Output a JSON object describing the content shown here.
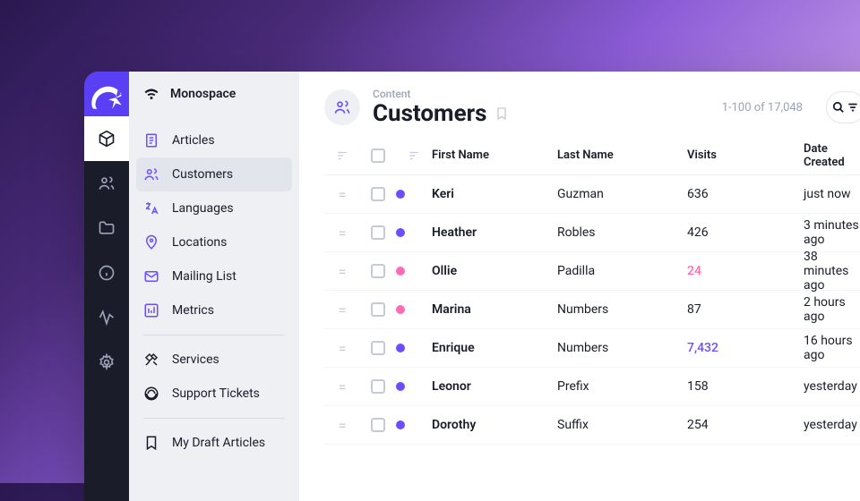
{
  "workspace": {
    "name": "Monospace"
  },
  "sidebar": {
    "items": [
      {
        "label": "Articles"
      },
      {
        "label": "Customers"
      },
      {
        "label": "Languages"
      },
      {
        "label": "Locations"
      },
      {
        "label": "Mailing List"
      },
      {
        "label": "Metrics"
      },
      {
        "label": "Services"
      },
      {
        "label": "Support Tickets"
      },
      {
        "label": "My Draft Articles"
      }
    ]
  },
  "header": {
    "breadcrumb": "Content",
    "title": "Customers",
    "pagination": "1-100 of 17,048"
  },
  "table": {
    "columns": {
      "first": "First Name",
      "last": "Last Name",
      "visits": "Visits",
      "date": "Date Created"
    },
    "rows": [
      {
        "first": "Keri",
        "last": "Guzman",
        "visits": "636",
        "date": "just now",
        "dot": "purple",
        "vclass": ""
      },
      {
        "first": "Heather",
        "last": "Robles",
        "visits": "426",
        "date": "3 minutes ago",
        "dot": "purple",
        "vclass": ""
      },
      {
        "first": "Ollie",
        "last": "Padilla",
        "visits": "24",
        "date": "38 minutes ago",
        "dot": "pink",
        "vclass": "pink"
      },
      {
        "first": "Marina",
        "last": "Numbers",
        "visits": "87",
        "date": "2 hours ago",
        "dot": "pink",
        "vclass": ""
      },
      {
        "first": "Enrique",
        "last": "Numbers",
        "visits": "7,432",
        "date": "16 hours ago",
        "dot": "purple",
        "vclass": "link"
      },
      {
        "first": "Leonor",
        "last": "Prefix",
        "visits": "158",
        "date": "yesterday",
        "dot": "purple",
        "vclass": ""
      },
      {
        "first": "Dorothy",
        "last": "Suffix",
        "visits": "254",
        "date": "yesterday",
        "dot": "purple",
        "vclass": ""
      }
    ]
  }
}
